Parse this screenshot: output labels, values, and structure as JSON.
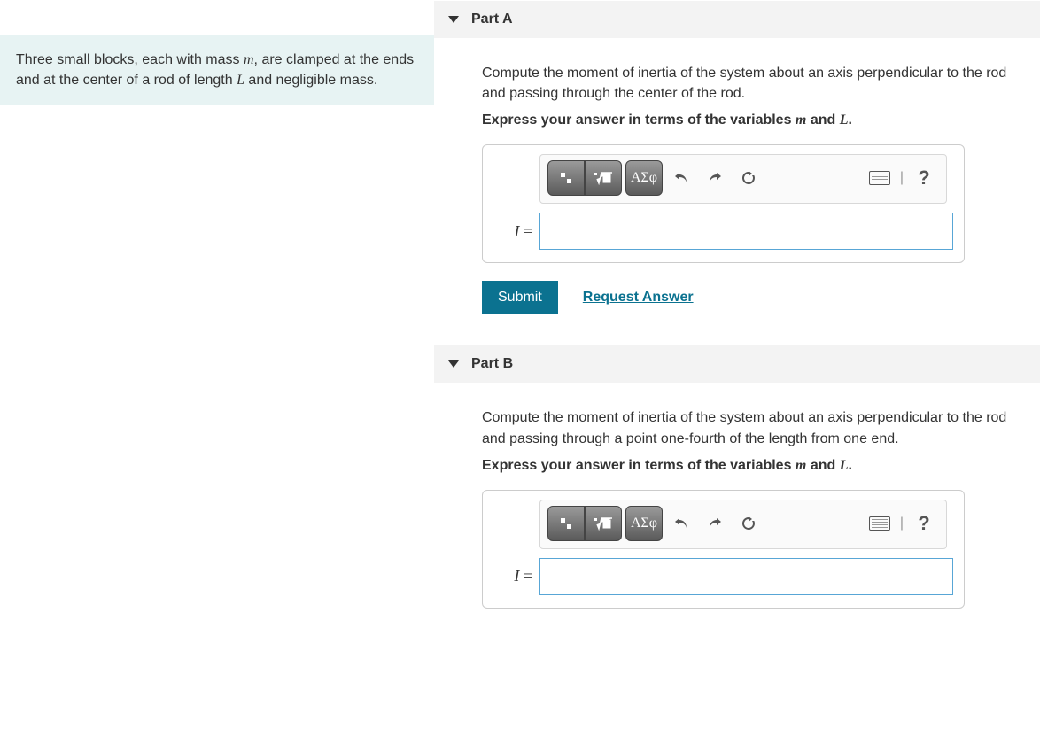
{
  "problem": {
    "text_prefix": "Three small blocks, each with mass ",
    "var_m": "m",
    "text_mid1": ", are clamped at the ends and at the center of a rod of length ",
    "var_L": "L",
    "text_suffix": " and negligible mass."
  },
  "partA": {
    "title": "Part A",
    "instruction": "Compute the moment of inertia of the system about an axis perpendicular to the rod and passing through the center of the rod.",
    "express_prefix": "Express your answer in terms of the variables ",
    "var_m": "m",
    "express_and": " and ",
    "var_L": "L",
    "express_suffix": ".",
    "var_label": "I",
    "equals": "=",
    "greek_label": "ΑΣφ",
    "help_label": "?",
    "submit_label": "Submit",
    "request_label": "Request Answer",
    "answer_value": ""
  },
  "partB": {
    "title": "Part B",
    "instruction": "Compute the moment of inertia of the system about an axis perpendicular to the rod and passing through a point one-fourth of the length from one end.",
    "express_prefix": "Express your answer in terms of the variables ",
    "var_m": "m",
    "express_and": " and ",
    "var_L": "L",
    "express_suffix": ".",
    "var_label": "I",
    "equals": "=",
    "greek_label": "ΑΣφ",
    "help_label": "?",
    "answer_value": ""
  }
}
